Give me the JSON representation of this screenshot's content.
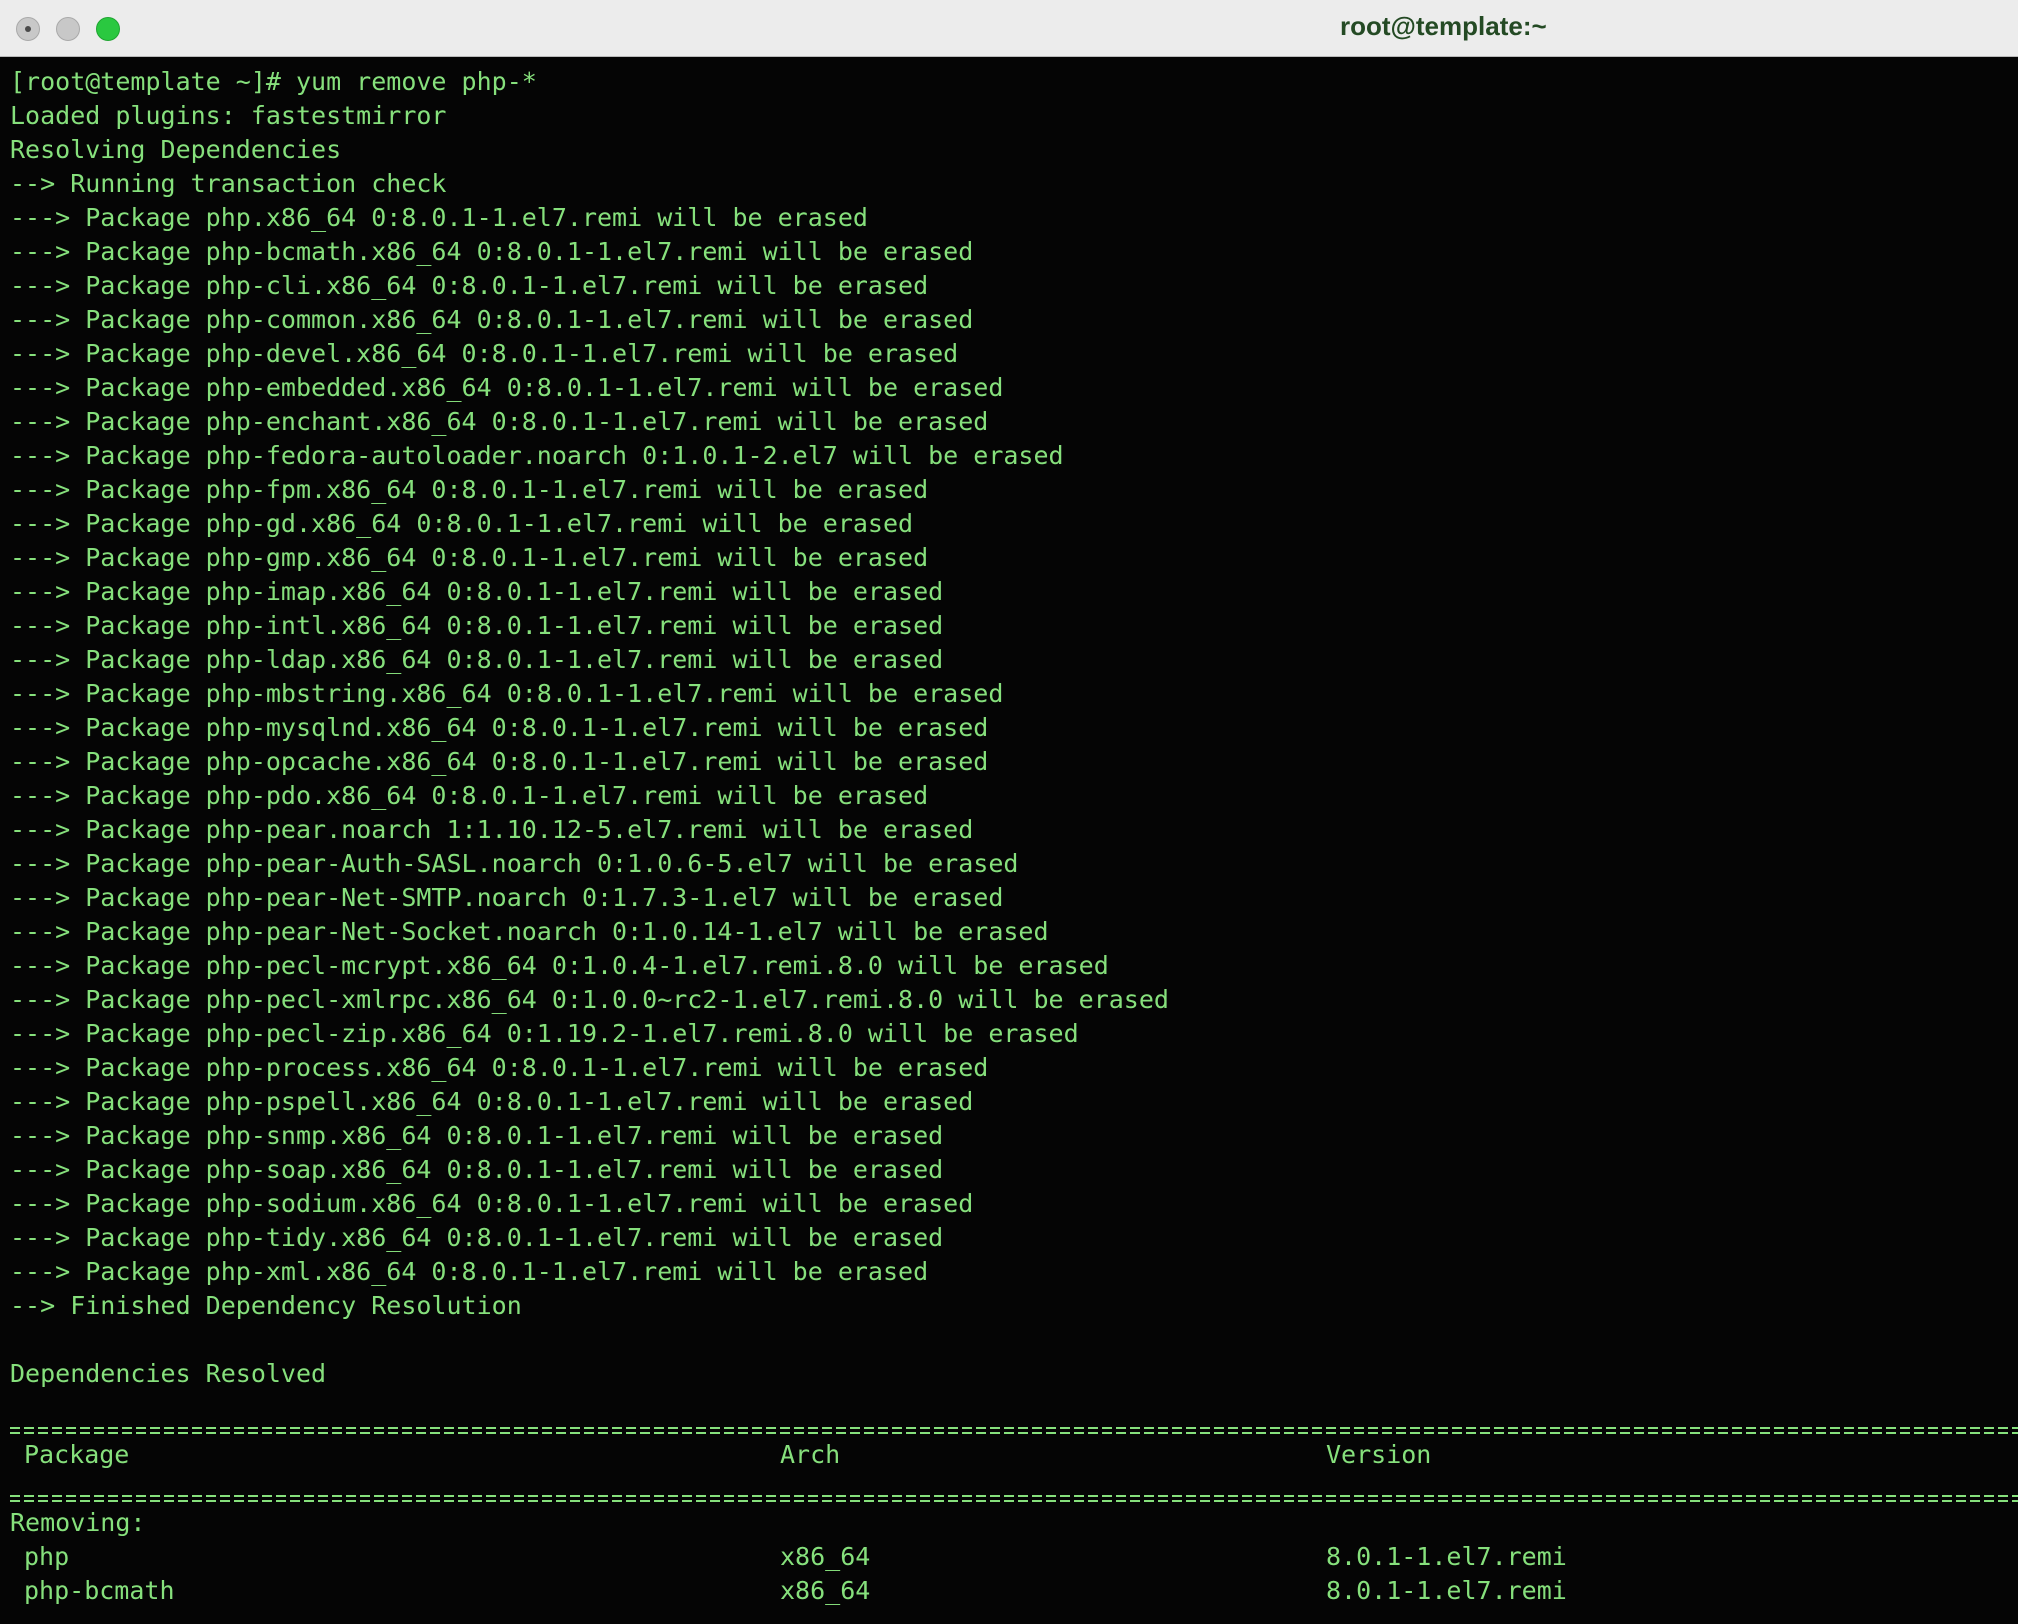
{
  "window": {
    "title": "root@template:~"
  },
  "terminal": {
    "lines": [
      "[root@template ~]# yum remove php-*",
      "Loaded plugins: fastestmirror",
      "Resolving Dependencies",
      "--> Running transaction check",
      "---> Package php.x86_64 0:8.0.1-1.el7.remi will be erased",
      "---> Package php-bcmath.x86_64 0:8.0.1-1.el7.remi will be erased",
      "---> Package php-cli.x86_64 0:8.0.1-1.el7.remi will be erased",
      "---> Package php-common.x86_64 0:8.0.1-1.el7.remi will be erased",
      "---> Package php-devel.x86_64 0:8.0.1-1.el7.remi will be erased",
      "---> Package php-embedded.x86_64 0:8.0.1-1.el7.remi will be erased",
      "---> Package php-enchant.x86_64 0:8.0.1-1.el7.remi will be erased",
      "---> Package php-fedora-autoloader.noarch 0:1.0.1-2.el7 will be erased",
      "---> Package php-fpm.x86_64 0:8.0.1-1.el7.remi will be erased",
      "---> Package php-gd.x86_64 0:8.0.1-1.el7.remi will be erased",
      "---> Package php-gmp.x86_64 0:8.0.1-1.el7.remi will be erased",
      "---> Package php-imap.x86_64 0:8.0.1-1.el7.remi will be erased",
      "---> Package php-intl.x86_64 0:8.0.1-1.el7.remi will be erased",
      "---> Package php-ldap.x86_64 0:8.0.1-1.el7.remi will be erased",
      "---> Package php-mbstring.x86_64 0:8.0.1-1.el7.remi will be erased",
      "---> Package php-mysqlnd.x86_64 0:8.0.1-1.el7.remi will be erased",
      "---> Package php-opcache.x86_64 0:8.0.1-1.el7.remi will be erased",
      "---> Package php-pdo.x86_64 0:8.0.1-1.el7.remi will be erased",
      "---> Package php-pear.noarch 1:1.10.12-5.el7.remi will be erased",
      "---> Package php-pear-Auth-SASL.noarch 0:1.0.6-5.el7 will be erased",
      "---> Package php-pear-Net-SMTP.noarch 0:1.7.3-1.el7 will be erased",
      "---> Package php-pear-Net-Socket.noarch 0:1.0.14-1.el7 will be erased",
      "---> Package php-pecl-mcrypt.x86_64 0:1.0.4-1.el7.remi.8.0 will be erased",
      "---> Package php-pecl-xmlrpc.x86_64 0:1.0.0~rc2-1.el7.remi.8.0 will be erased",
      "---> Package php-pecl-zip.x86_64 0:1.19.2-1.el7.remi.8.0 will be erased",
      "---> Package php-process.x86_64 0:8.0.1-1.el7.remi will be erased",
      "---> Package php-pspell.x86_64 0:8.0.1-1.el7.remi will be erased",
      "---> Package php-snmp.x86_64 0:8.0.1-1.el7.remi will be erased",
      "---> Package php-soap.x86_64 0:8.0.1-1.el7.remi will be erased",
      "---> Package php-sodium.x86_64 0:8.0.1-1.el7.remi will be erased",
      "---> Package php-tidy.x86_64 0:8.0.1-1.el7.remi will be erased",
      "---> Package php-xml.x86_64 0:8.0.1-1.el7.remi will be erased",
      "--> Finished Dependency Resolution",
      "",
      "Dependencies Resolved"
    ],
    "table": {
      "headers": {
        "package": "Package",
        "arch": "Arch",
        "version": "Version"
      },
      "section": "Removing:",
      "rows": [
        {
          "package": "php",
          "arch": "x86_64",
          "version": "8.0.1-1.el7.remi"
        },
        {
          "package": "php-bcmath",
          "arch": "x86_64",
          "version": "8.0.1-1.el7.remi"
        }
      ]
    }
  },
  "colors": {
    "text": "#86e07c",
    "background": "#050505",
    "titlebar": "#ececec"
  }
}
